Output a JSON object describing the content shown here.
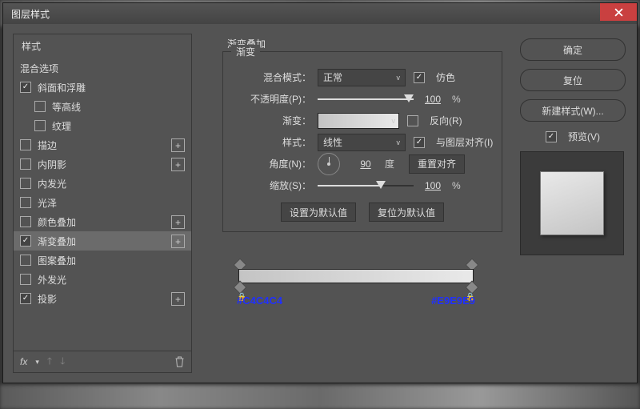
{
  "window": {
    "title": "图层样式"
  },
  "left": {
    "header_styles": "样式",
    "header_blend": "混合选项",
    "items": [
      {
        "label": "斜面和浮雕",
        "checked": true,
        "plus": false,
        "sub": false
      },
      {
        "label": "等高线",
        "checked": false,
        "plus": false,
        "sub": true
      },
      {
        "label": "纹理",
        "checked": false,
        "plus": false,
        "sub": true
      },
      {
        "label": "描边",
        "checked": false,
        "plus": true,
        "sub": false
      },
      {
        "label": "内阴影",
        "checked": false,
        "plus": true,
        "sub": false
      },
      {
        "label": "内发光",
        "checked": false,
        "plus": false,
        "sub": false
      },
      {
        "label": "光泽",
        "checked": false,
        "plus": false,
        "sub": false
      },
      {
        "label": "颜色叠加",
        "checked": false,
        "plus": true,
        "sub": false
      },
      {
        "label": "渐变叠加",
        "checked": true,
        "plus": true,
        "sub": false,
        "selected": true
      },
      {
        "label": "图案叠加",
        "checked": false,
        "plus": false,
        "sub": false
      },
      {
        "label": "外发光",
        "checked": false,
        "plus": false,
        "sub": false
      },
      {
        "label": "投影",
        "checked": true,
        "plus": true,
        "sub": false
      }
    ],
    "footer_fx": "fx"
  },
  "mid": {
    "title": "渐变叠加",
    "legend": "渐变",
    "labels": {
      "blend": "混合模式：",
      "opacity": "不透明度(P)：",
      "gradient": "渐变：",
      "style": "样式：",
      "angle": "角度(N)：",
      "scale": "缩放(S)："
    },
    "blend_value": "正常",
    "dither": "仿色",
    "opacity": {
      "value": "100",
      "unit": "%"
    },
    "reverse": "反向(R)",
    "style_value": "线性",
    "align": "与图层对齐(I)",
    "angle": {
      "value": "90",
      "unit": "度"
    },
    "reset_align": "重置对齐",
    "scale": {
      "value": "100",
      "unit": "%"
    },
    "btn_set_default": "设置为默认值",
    "btn_reset_default": "复位为默认值",
    "hex_left": "#C4C4C4",
    "hex_right": "#E9E9E9"
  },
  "right": {
    "ok": "确定",
    "reset": "复位",
    "new_style": "新建样式(W)...",
    "preview": "预览(V)"
  }
}
